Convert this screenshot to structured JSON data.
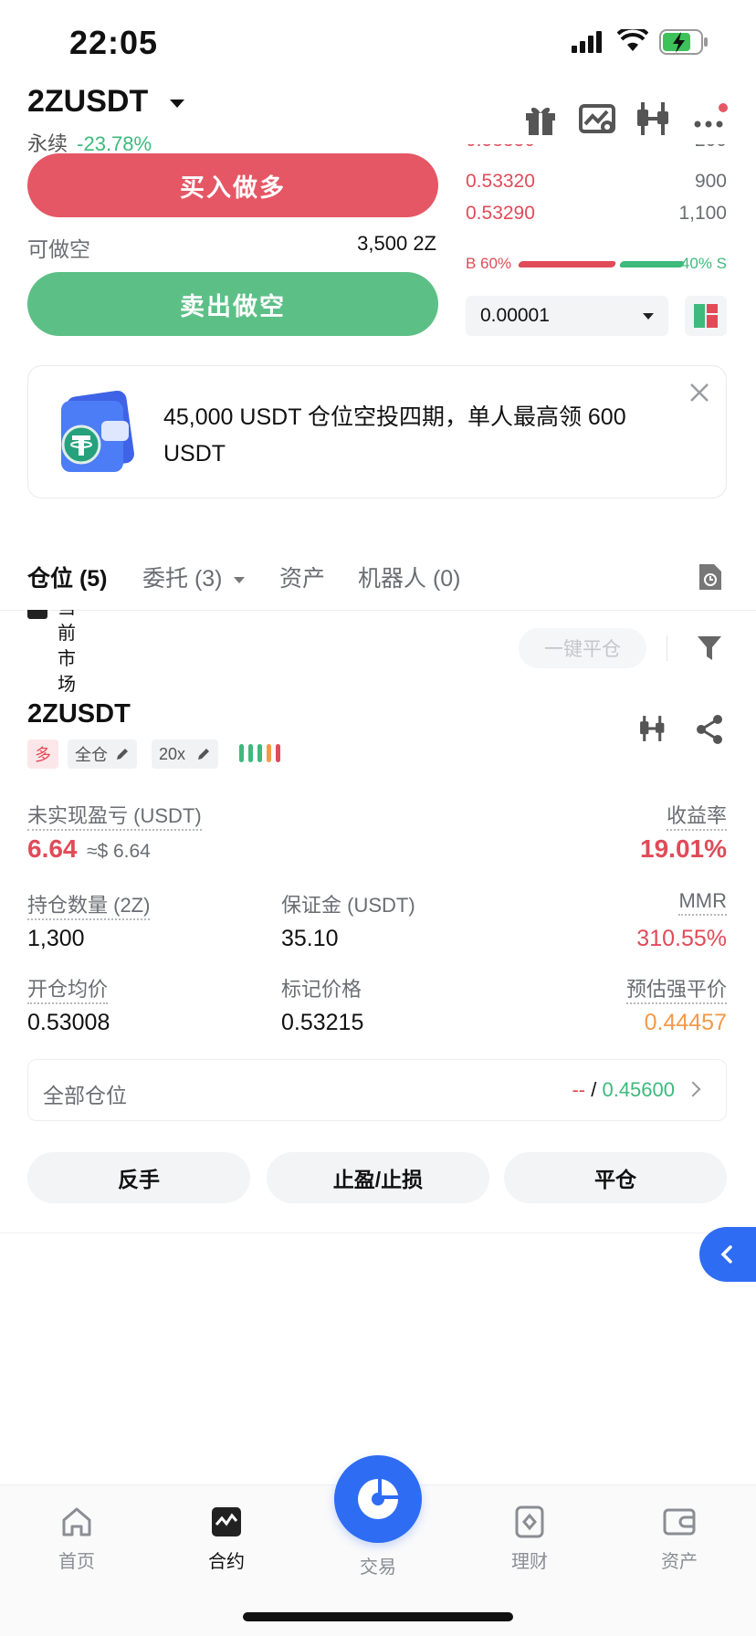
{
  "status_bar": {
    "time": "22:05"
  },
  "header": {
    "symbol": "2ZUSDT",
    "contract_type": "永续",
    "change_pct": "-23.78%"
  },
  "order_book": {
    "rows": [
      {
        "price": "0.53330",
        "qty": "200"
      },
      {
        "price": "0.53320",
        "qty": "900"
      },
      {
        "price": "0.53290",
        "qty": "1,100"
      }
    ],
    "buy_ratio": "B 60%",
    "sell_ratio": "40% S",
    "buy_fraction": 0.6,
    "precision": "0.00001"
  },
  "trade_panel": {
    "buy_label": "买入做多",
    "sell_label": "卖出做空",
    "available_label": "可做空",
    "available_value": "3,500 2Z"
  },
  "promo": {
    "text": "45,000 USDT 仓位空投四期，单人最高领 600 USDT"
  },
  "tabs": [
    {
      "label": "仓位 (5)"
    },
    {
      "label": "委托 (3)"
    },
    {
      "label": "资产"
    },
    {
      "label": "机器人 (0)"
    }
  ],
  "filter": {
    "current_market_label": "当前市场",
    "close_all_label": "一键平仓"
  },
  "position": {
    "symbol": "2ZUSDT",
    "side_tag": "多",
    "margin_mode": "全仓",
    "leverage": "20x",
    "unrealized_pnl_label": "未实现盈亏 (USDT)",
    "unrealized_pnl": "6.64",
    "unrealized_pnl_usd": "≈$ 6.64",
    "roe_label": "收益率",
    "roe": "19.01%",
    "size_label": "持仓数量 (2Z)",
    "size": "1,300",
    "margin_label": "保证金 (USDT)",
    "margin": "35.10",
    "mmr_label": "MMR",
    "mmr": "310.55%",
    "entry_label": "开仓均价",
    "entry": "0.53008",
    "mark_label": "标记价格",
    "mark": "0.53215",
    "liq_label": "预估强平价",
    "liq": "0.44457",
    "all_positions_label": "全部仓位",
    "all_positions_tp": "--",
    "all_positions_sep": " / ",
    "all_positions_sl": "0.45600",
    "actions": {
      "reverse": "反手",
      "tpsl": "止盈/止损",
      "close": "平仓"
    }
  },
  "bottom_nav": [
    {
      "label": "首页",
      "icon": "home-icon"
    },
    {
      "label": "合约",
      "icon": "futures-icon"
    },
    {
      "label": "交易",
      "icon": "trade-icon"
    },
    {
      "label": "理财",
      "icon": "earn-icon"
    },
    {
      "label": "资产",
      "icon": "wallet-icon"
    }
  ],
  "colors": {
    "up": "#3dba7c",
    "down": "#e04b58",
    "accent": "#2e6cf4",
    "warning": "#f29a49"
  }
}
